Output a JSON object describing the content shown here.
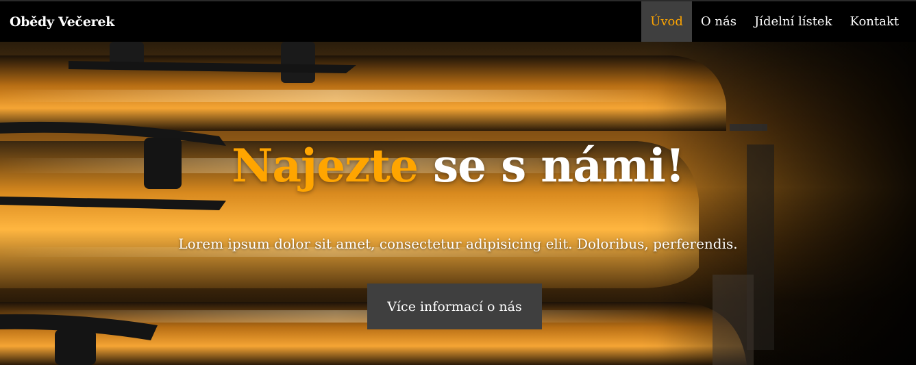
{
  "navbar": {
    "brand": "Obědy Večerek",
    "links": [
      {
        "label": "Úvod",
        "active": true
      },
      {
        "label": "O nás",
        "active": false
      },
      {
        "label": "Jídelní lístek",
        "active": false
      },
      {
        "label": "Kontakt",
        "active": false
      }
    ]
  },
  "hero": {
    "title_accent": "Najezte",
    "title_rest": " se s námi!",
    "subtitle": "Lorem ipsum dolor sit amet, consectetur adipisicing elit. Doloribus, perferendis.",
    "button_label": "Více informací o nás"
  },
  "colors": {
    "accent": "#ffa500",
    "navbar_bg": "#000000",
    "active_bg": "#3f3f3f",
    "button_bg": "#3f3f3f",
    "text": "#ffffff"
  }
}
